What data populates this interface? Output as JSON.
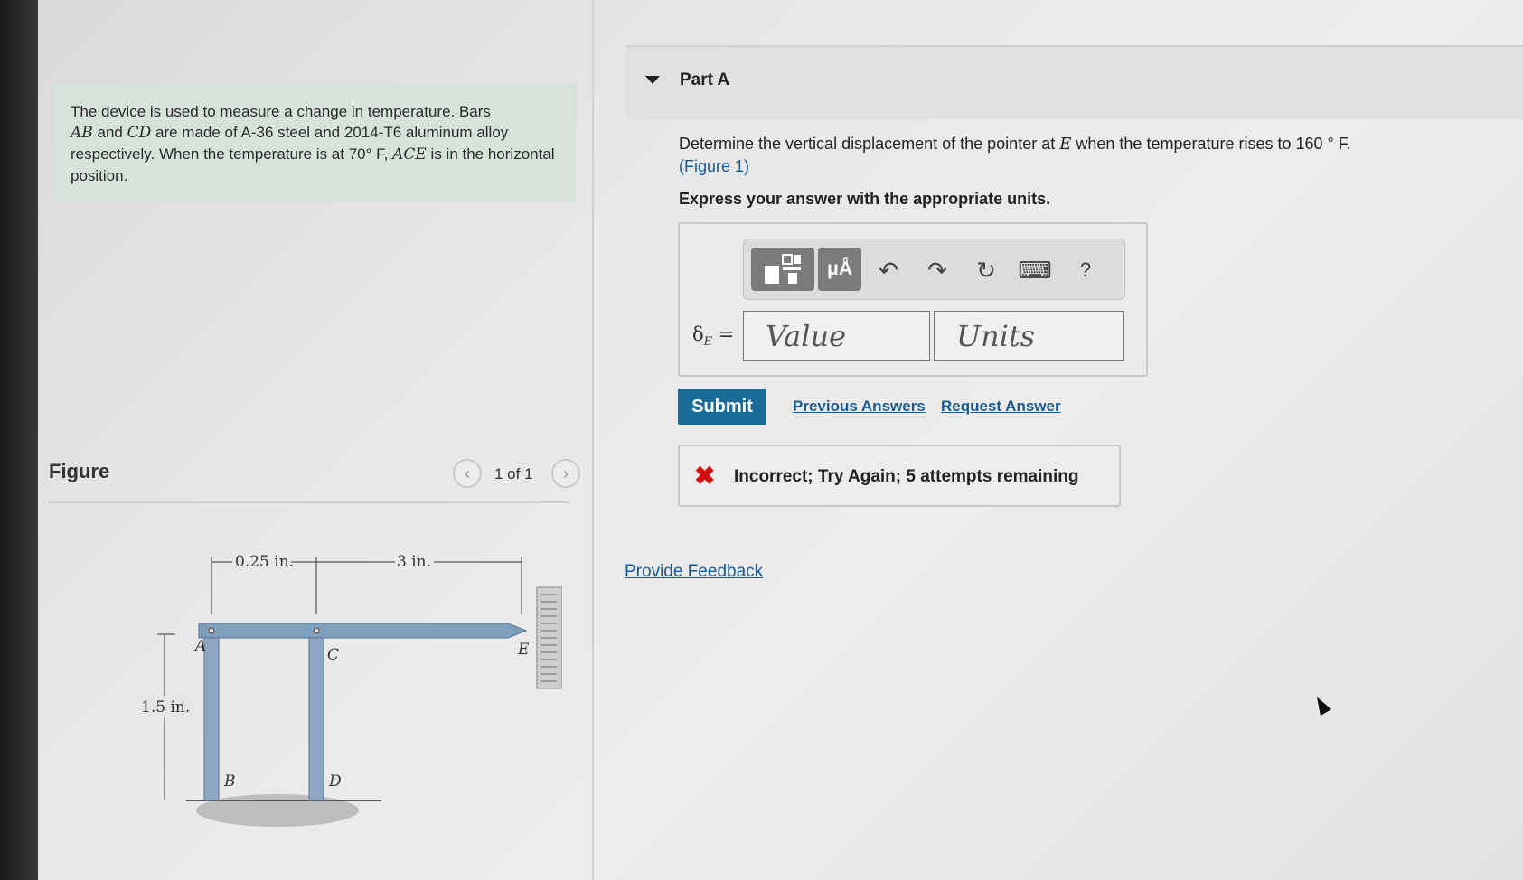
{
  "problem": {
    "text_1": "The device is used to measure a change in temperature. Bars",
    "bar_ab": "AB",
    "text_2": "and",
    "bar_cd": "CD",
    "text_3": "are made of A-36 steel and 2014-T6 aluminum alloy respectively. When the temperature is at 70",
    "deg_f": "° F,",
    "ace": "ACE",
    "text_4": "is in the horizontal position."
  },
  "figure": {
    "title": "Figure",
    "pager": "1 of 1",
    "prev_icon": "chevron-left-icon",
    "next_icon": "chevron-right-icon",
    "dim_a": "0.25 in.",
    "dim_b": "3 in.",
    "dim_h": "1.5 in.",
    "label_a": "A",
    "label_b": "B",
    "label_c": "C",
    "label_d": "D",
    "label_e": "E"
  },
  "part": {
    "title": "Part A",
    "question_1": "Determine the vertical displacement of the pointer at",
    "point_e": "E",
    "question_2": "when the temperature rises to 160",
    "deg_f": "° F.",
    "figure_link": "(Figure 1)",
    "instruction": "Express your answer with the appropriate units."
  },
  "answer": {
    "label_delta": "δ",
    "label_sub": "E",
    "label_eq": " =",
    "value_placeholder": "Value",
    "units_placeholder": "Units",
    "toolbar": {
      "template_icon": "template-icon",
      "units_label": "μÅ",
      "undo_icon": "↶",
      "redo_icon": "↷",
      "reset_icon": "↻",
      "keyboard_icon": "⌨",
      "help_label": "?"
    }
  },
  "actions": {
    "submit": "Submit",
    "previous_answers": "Previous Answers",
    "request_answer": "Request Answer"
  },
  "feedback": {
    "icon": "✖",
    "text": "Incorrect; Try Again; 5 attempts remaining"
  },
  "provide_feedback": "Provide Feedback",
  "colors": {
    "submit_bg": "#1a6b96",
    "link": "#1a5a90",
    "error": "#d01010",
    "problem_bg": "#d6e3db",
    "bar_fill": "#8fa7c4"
  }
}
